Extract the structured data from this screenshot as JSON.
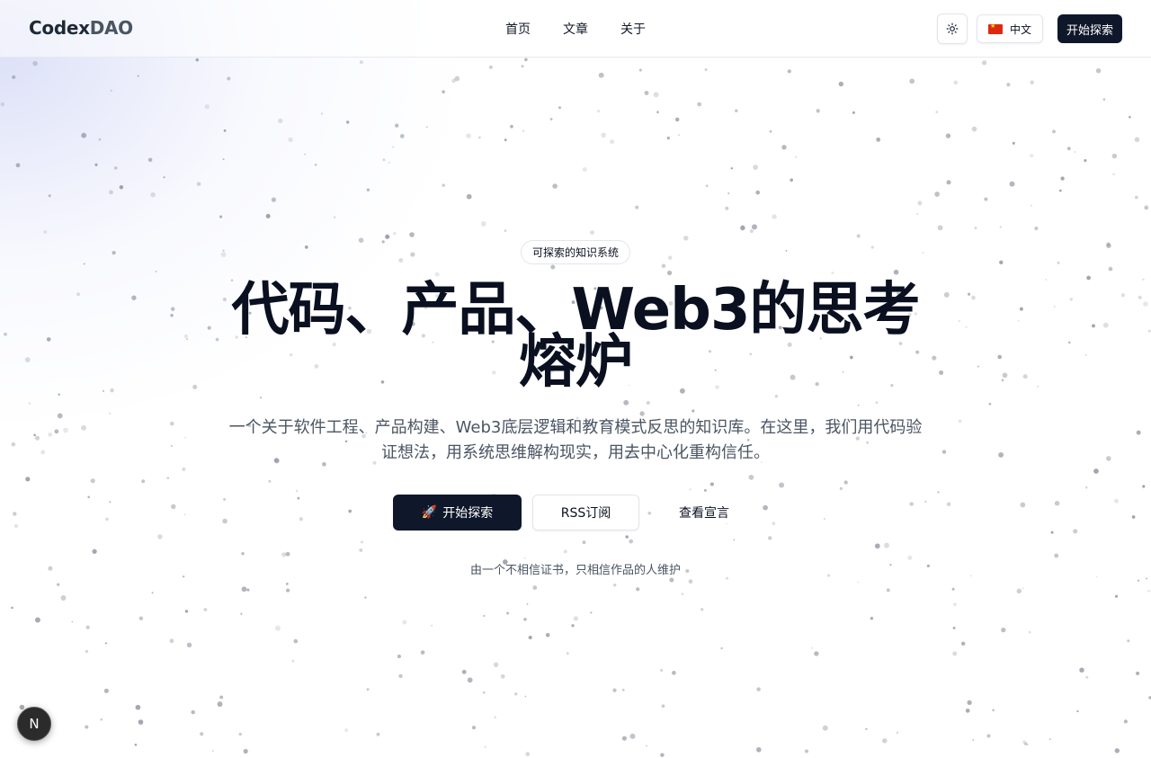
{
  "header": {
    "logo_primary": "Codex",
    "logo_secondary": "DAO",
    "nav": [
      "首页",
      "文章",
      "关于"
    ],
    "theme_icon": "sun-icon",
    "language": {
      "flag_icon": "china-flag-icon",
      "label": "中文"
    },
    "cta_label": "开始探索"
  },
  "hero": {
    "badge": "可探索的知识系统",
    "title": "代码、产品、Web3的思考熔炉",
    "subtitle": "一个关于软件工程、产品构建、Web3底层逻辑和教育模式反思的知识库。在这里，我们用代码验证想法，用系统思维解构现实，用去中心化重构信任。",
    "primary_icon": "🚀",
    "primary_label": "开始探索",
    "secondary_label": "RSS订阅",
    "ghost_label": "查看宣言",
    "footnote": "由一个不相信证书，只相信作品的人维护"
  },
  "dev_badge": {
    "label": "N",
    "icon": "nextjs-dev-indicator-icon"
  },
  "colors": {
    "primary_dark": "#0f172a",
    "text": "#0b1020",
    "muted": "#4b5563",
    "border": "#e2e5ec",
    "gradient_tint": "#d2d7f5"
  }
}
